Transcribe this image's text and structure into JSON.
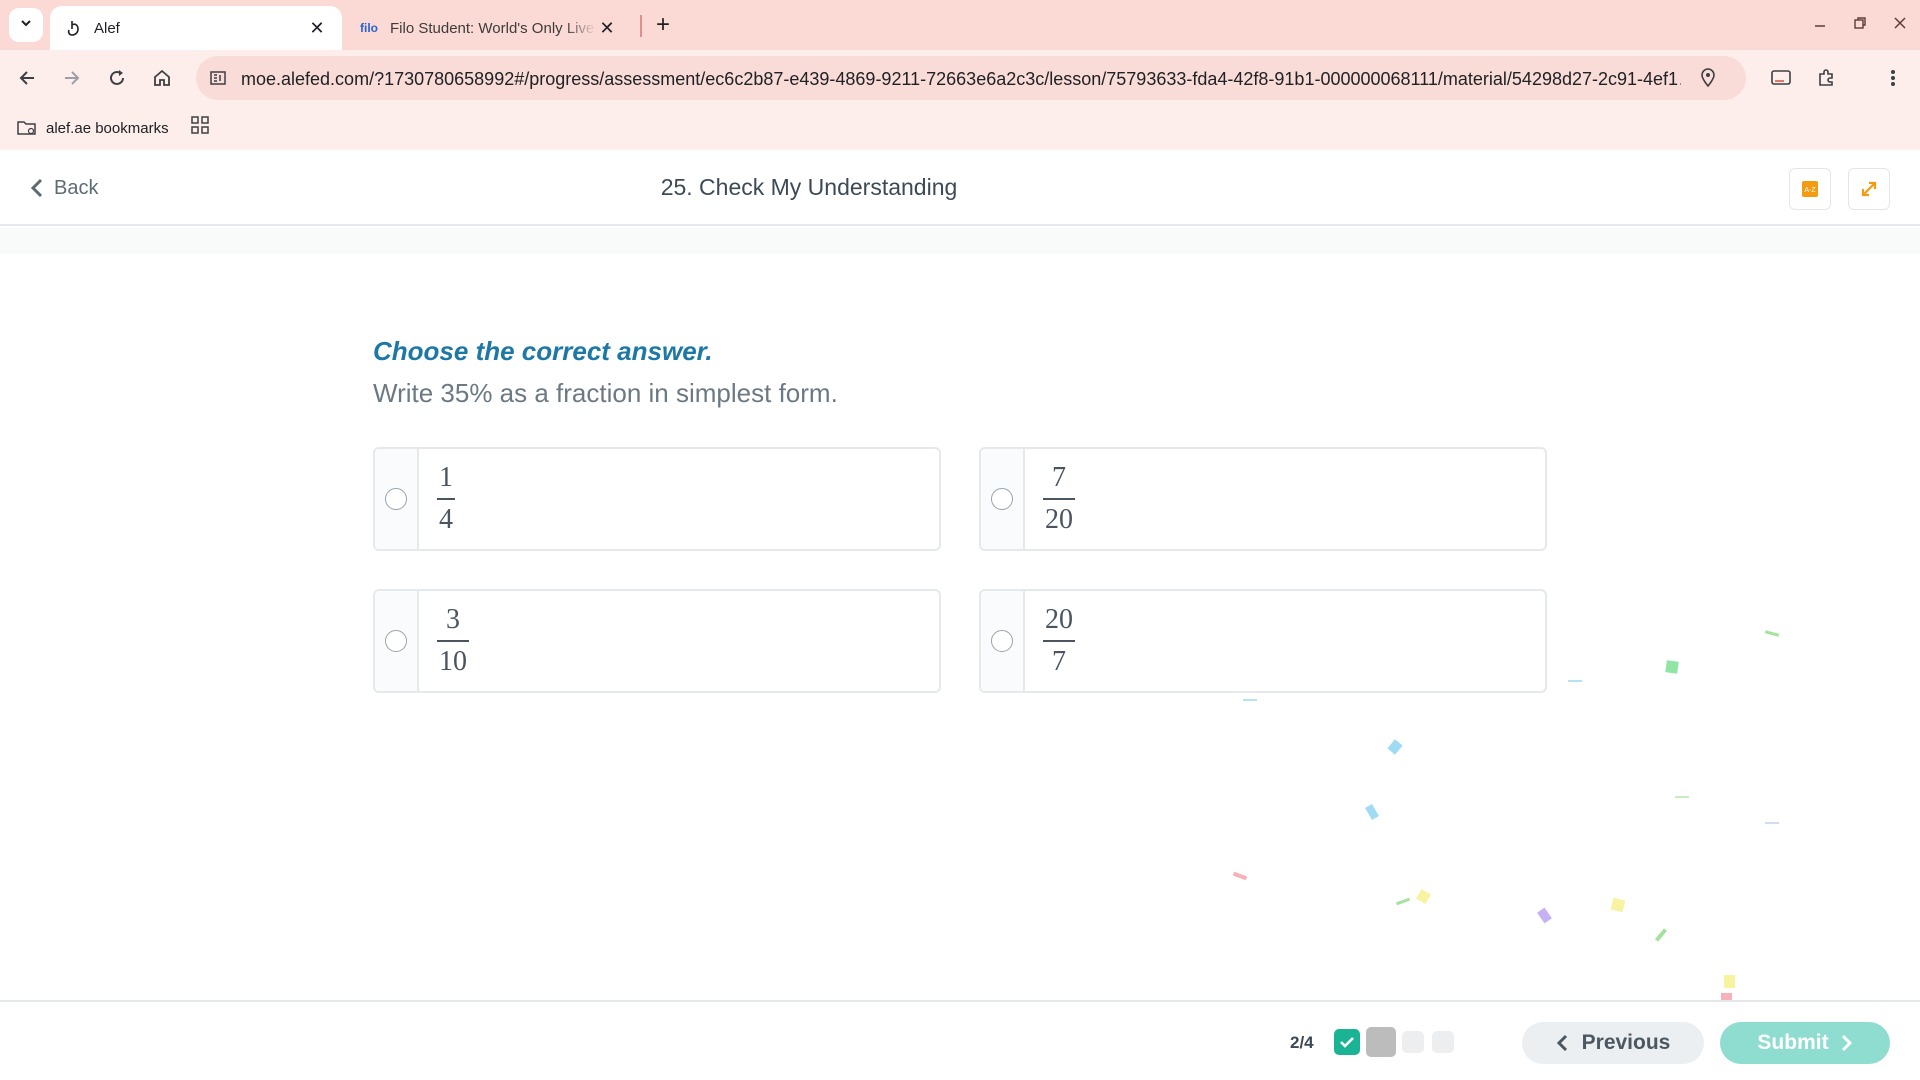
{
  "browser": {
    "tabs": [
      {
        "title": "Alef",
        "active": true
      },
      {
        "title": "Filo Student: World's Only Live Instant Tutoring Platform",
        "active": false,
        "favicon_text": "filo"
      }
    ],
    "url": "moe.alefed.com/?1730780658992#/progress/assessment/ec6c2b87-e439-4869-9211-72663e6a2c3c/lesson/75793633-fda4-42f8-91b1-000000068111/material/54298d27-2c91-4ef1…",
    "bookmarks": [
      {
        "label": "alef.ae bookmarks"
      }
    ]
  },
  "header": {
    "back_label": "Back",
    "title": "25. Check My Understanding"
  },
  "question": {
    "instruction": "Choose the correct answer.",
    "prompt": "Write 35% as a fraction in simplest form.",
    "options": [
      {
        "numerator": "1",
        "denominator": "4"
      },
      {
        "numerator": "7",
        "denominator": "20"
      },
      {
        "numerator": "3",
        "denominator": "10"
      },
      {
        "numerator": "20",
        "denominator": "7"
      }
    ]
  },
  "footer": {
    "progress_text": "2/4",
    "progress_states": [
      "done",
      "current",
      "pending",
      "pending"
    ],
    "previous_label": "Previous",
    "submit_label": "Submit"
  },
  "colors": {
    "accent": "#1e78a6",
    "submit": "#8fdcd0",
    "done": "#1ab394",
    "tabstrip": "#fbd9d4",
    "tool_icons": "#f39c12"
  }
}
